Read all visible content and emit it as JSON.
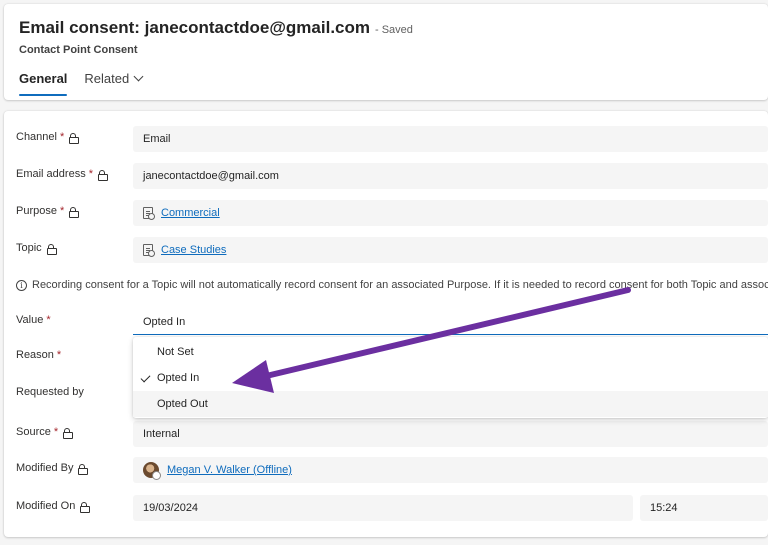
{
  "header": {
    "title": "Email consent: janecontactdoe@gmail.com",
    "saved": "- Saved",
    "subtitle": "Contact Point Consent",
    "tabs": [
      {
        "label": "General"
      },
      {
        "label": "Related"
      }
    ]
  },
  "form": {
    "channel": {
      "label": "Channel",
      "required": "*",
      "value": "Email"
    },
    "email": {
      "label": "Email address",
      "required": "*",
      "value": "janecontactdoe@gmail.com"
    },
    "purpose": {
      "label": "Purpose",
      "required": "*",
      "value": "Commercial"
    },
    "topic": {
      "label": "Topic",
      "value": "Case Studies"
    },
    "info": "Recording consent for a Topic will not automatically record consent for an associated Purpose. If it is needed to record consent for both Topic and associate",
    "value": {
      "label": "Value",
      "required": "*",
      "value": "Opted In"
    },
    "reason": {
      "label": "Reason",
      "required": "*"
    },
    "requested_by": {
      "label": "Requested by"
    },
    "source": {
      "label": "Source",
      "required": "*",
      "value": "Internal"
    },
    "modified_by": {
      "label": "Modified By",
      "value": "Megan V. Walker (Offline)"
    },
    "modified_on": {
      "label": "Modified On",
      "date": "19/03/2024",
      "time": "15:24"
    }
  },
  "dropdown": {
    "options": [
      "Not Set",
      "Opted In",
      "Opted Out"
    ],
    "selected": "Opted In"
  },
  "colors": {
    "accent": "#0f6cbd",
    "required": "#a4262c",
    "arrow": "#6b2fa0"
  }
}
